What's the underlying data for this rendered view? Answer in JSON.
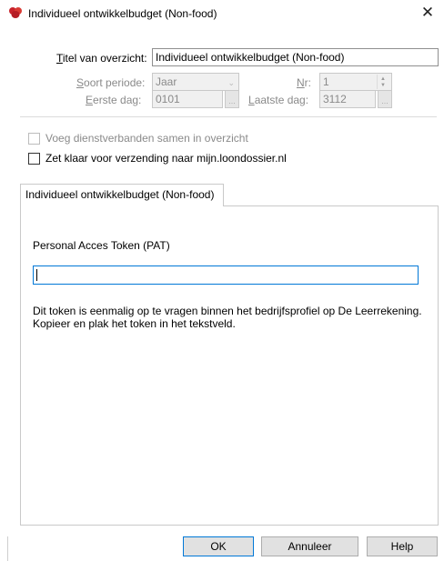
{
  "window": {
    "title": "Individueel ontwikkelbudget (Non-food)",
    "icon": "red-flower-app-icon",
    "close_glyph": "✕"
  },
  "form": {
    "titel": {
      "label_u": "T",
      "label_rest": "itel van overzicht:",
      "value": "Individueel ontwikkelbudget (Non-food)"
    },
    "soort_periode": {
      "label_u": "S",
      "label_rest": "oort periode:",
      "value": "Jaar"
    },
    "nr": {
      "label_u": "N",
      "label_rest": "r:",
      "value": "1"
    },
    "eerste_dag": {
      "label_u": "E",
      "label_rest": "erste dag:",
      "value": "0101"
    },
    "laatste_dag": {
      "label_u": "L",
      "label_rest": "aatste dag:",
      "value": "3112"
    },
    "browse_glyph": "..."
  },
  "options": {
    "dienstverbanden": {
      "label": "Voeg dienstverbanden samen in overzicht",
      "checked": false,
      "enabled": false
    },
    "verzending": {
      "label": "Zet klaar voor verzending naar mijn.loondossier.nl",
      "checked": false,
      "enabled": true
    }
  },
  "tab": {
    "label": "Individueel ontwikkelbudget (Non-food)"
  },
  "panel": {
    "pat_label": "Personal Acces Token (PAT)",
    "pat_value": "",
    "help_line1": "Dit token is eenmalig op te vragen binnen het bedrijfsprofiel op De Leerrekening.",
    "help_line2": "Kopieer en plak het token in het tekstveld."
  },
  "buttons": {
    "ok": "OK",
    "cancel": "Annuleer",
    "help": "Help"
  },
  "colors": {
    "accent": "#0078d7",
    "button_face": "#e1e1e1",
    "disabled_text": "#8a8a8a",
    "icon_red": "#c8232c"
  }
}
